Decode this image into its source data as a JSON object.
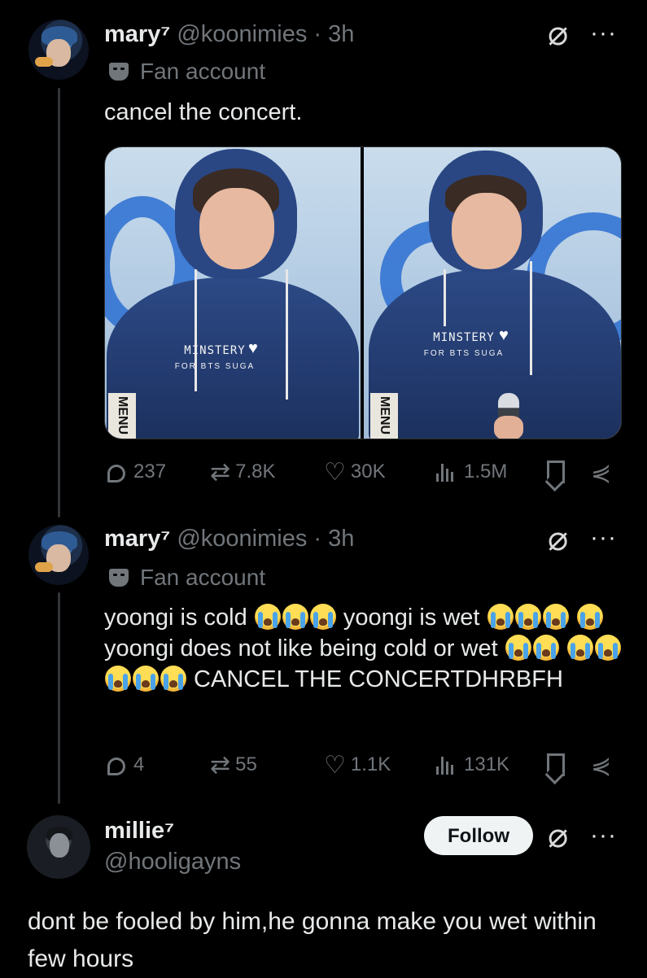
{
  "tweet1": {
    "display_name": "mary⁷",
    "handle": "@koonimies",
    "dot": "·",
    "time": "3h",
    "badge_label": "Fan account",
    "text": "cancel the concert.",
    "media": [
      {
        "watermark": "MINSTERY",
        "watermark_sub": "FOR BTS SUGA",
        "sign_text": "MENU"
      },
      {
        "watermark": "MINSTERY",
        "watermark_sub": "FOR BTS SUGA",
        "sign_text": "MENU"
      }
    ],
    "actions": {
      "replies": "237",
      "reposts": "7.8K",
      "likes": "30K",
      "views": "1.5M"
    }
  },
  "tweet2": {
    "display_name": "mary⁷",
    "handle": "@koonimies",
    "dot": "·",
    "time": "3h",
    "badge_label": "Fan account",
    "text_parts": {
      "p1": "yoongi is cold ",
      "p2": " yoongi is wet ",
      "p3": " yoongi does not like being cold or wet ",
      "p4": " CANCEL THE CONCERTDHRBFH"
    },
    "emoji_name": "loudly-crying-face",
    "actions": {
      "replies": "4",
      "reposts": "55",
      "likes": "1.1K",
      "views": "131K"
    }
  },
  "reply": {
    "display_name": "millie⁷",
    "handle": "@hooligayns",
    "follow_label": "Follow",
    "text": "dont be fooled by him,he gonna make you wet within few hours"
  },
  "icons": {
    "grok": "grok-icon",
    "more": "more-icon",
    "reply": "reply-icon",
    "repost": "repost-icon",
    "like": "heart-icon",
    "views": "views-icon",
    "bookmark": "bookmark-icon",
    "share": "share-icon"
  },
  "colors": {
    "background": "#000000",
    "text": "#e7e9ea",
    "secondary": "#71767b",
    "follow_button": "#eff3f4"
  }
}
